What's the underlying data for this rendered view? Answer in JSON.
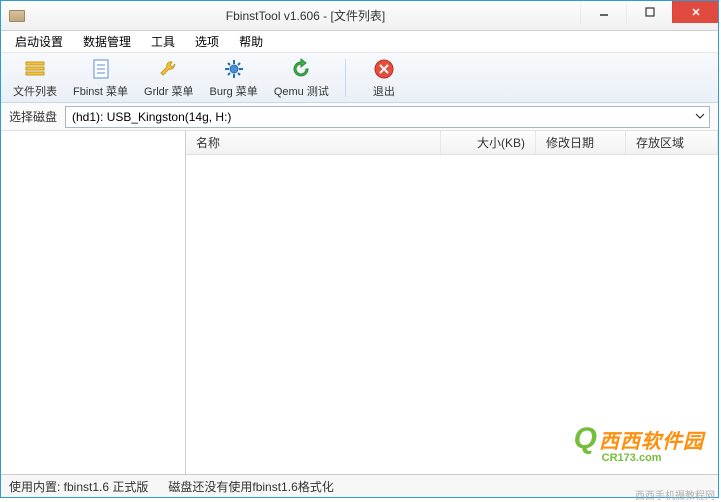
{
  "window": {
    "title": "FbinstTool v1.606 - [文件列表]"
  },
  "menu": {
    "items": [
      "启动设置",
      "数据管理",
      "工具",
      "选项",
      "帮助"
    ]
  },
  "toolbar": {
    "file_list": "文件列表",
    "fbinst_menu": "Fbinst 菜单",
    "grldr_menu": "Grldr 菜单",
    "burg_menu": "Burg 菜单",
    "qemu_test": "Qemu 测试",
    "exit": "退出"
  },
  "disk": {
    "label": "选择磁盘",
    "selected": "(hd1): USB_Kingston(14g, H:)"
  },
  "columns": {
    "name": "名称",
    "size": "大小(KB)",
    "date": "修改日期",
    "area": "存放区域"
  },
  "status": {
    "kernel": "使用内置: fbinst1.6 正式版",
    "disk_state": "磁盘还没有使用fbinst1.6格式化"
  },
  "watermark": {
    "brand": "西西软件园",
    "url": "CR173.com",
    "extra": "西西手机摄教程网"
  }
}
